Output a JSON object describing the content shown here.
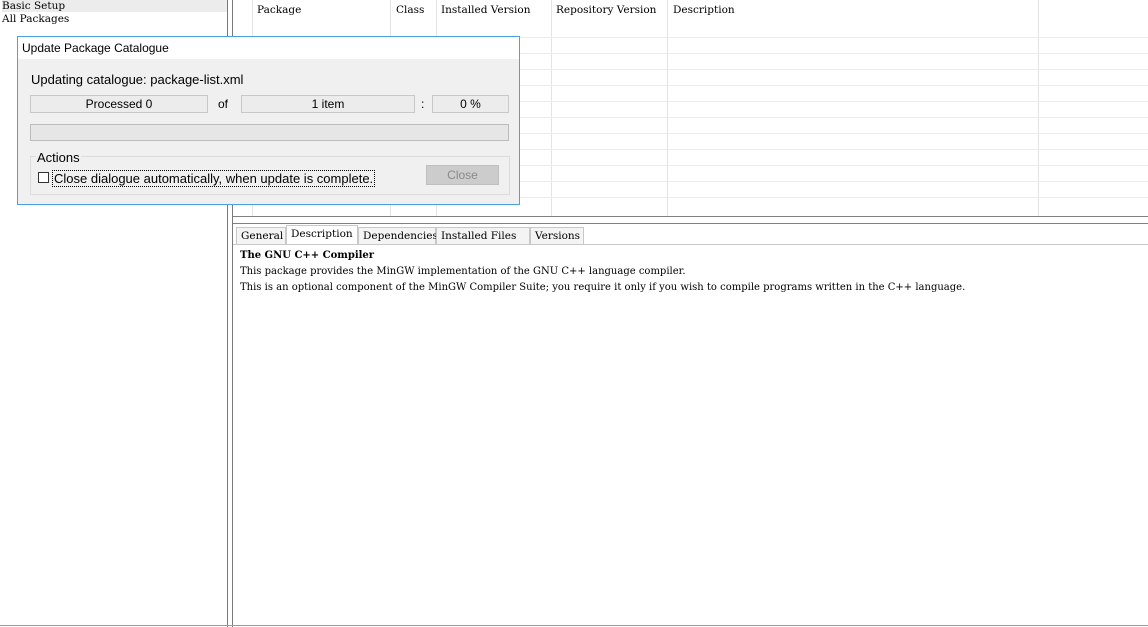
{
  "categories": [
    "Basic Setup",
    "All Packages"
  ],
  "package_list": {
    "columns": [
      "Package",
      "Class",
      "Installed Version",
      "Repository Version",
      "Description"
    ]
  },
  "tabs": [
    "General",
    "Description",
    "Dependencies",
    "Installed Files",
    "Versions"
  ],
  "active_tab": "Description",
  "description": {
    "title": "The GNU C++ Compiler",
    "lines": [
      "This package provides the MinGW implementation of the GNU C++ language compiler.",
      "This is an optional component of the MinGW Compiler Suite; you require it only if you wish to compile programs written in the C++ language."
    ]
  },
  "dialog": {
    "title": "Update Package Catalogue",
    "status": "Updating catalogue: package-list.xml",
    "processed": "Processed 0",
    "of_label": "of",
    "total": "1 item",
    "colon": ":",
    "percent": "0 %",
    "progress_fraction": 0,
    "actions_label": "Actions",
    "auto_close_label": "Close dialogue automatically, when update is complete.",
    "auto_close_checked": false,
    "close_button": "Close"
  },
  "colors": {
    "dialog_border": "#4aa3df",
    "dialog_bg": "#f0f0f0"
  }
}
